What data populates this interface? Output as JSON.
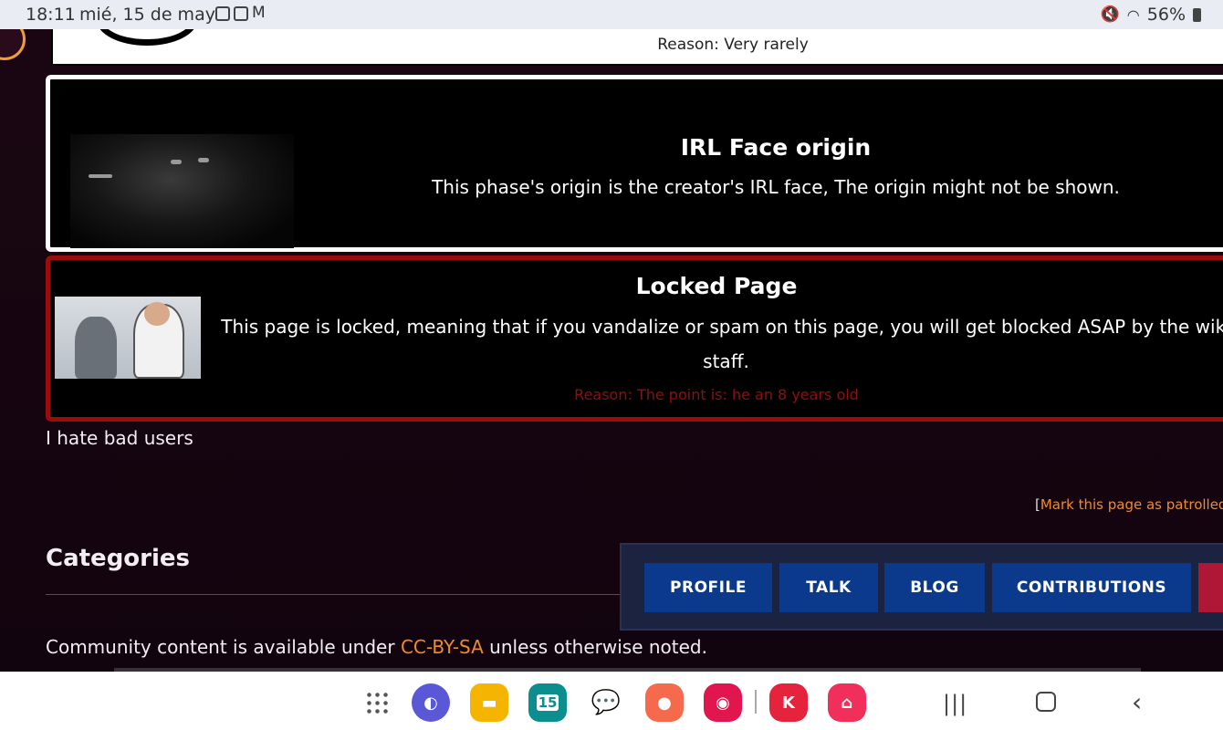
{
  "status_bar": {
    "time": "18:11",
    "date": "mié, 15 de may",
    "battery": "56%",
    "notification_icons": [
      "gallery-icon",
      "messenger-icon",
      "gmail-icon"
    ],
    "system_icons": [
      "mute-icon",
      "wifi-icon",
      "battery-icon"
    ]
  },
  "top_box": {
    "reason": "Reason: Very rarely"
  },
  "irl_box": {
    "title": "IRL Face origin",
    "text": "This phase's origin is the creator's IRL face, The origin might not be shown."
  },
  "locked_box": {
    "title": "Locked Page",
    "text": "This page is locked, meaning that if you vandalize or spam on this page, you will get blocked ASAP by the wiki staff.",
    "reason": "Reason: The point is: he an 8 years old",
    "border_color": "#9a0d0d",
    "reason_color": "#8e1010"
  },
  "content": {
    "hate_text": "I hate bad users",
    "patrol_bracket": "[",
    "patrol_link": "Mark this page as patrolled",
    "categories_heading": "Categories",
    "footer_prefix": "Community content is available under ",
    "footer_link": "CC-BY-SA",
    "footer_suffix": " unless otherwise noted.",
    "link_color": "#f08a2c"
  },
  "user_tabs": {
    "profile": "PROFILE",
    "talk": "TALK",
    "blog": "BLOG",
    "contributions": "CONTRIBUTIONS",
    "tab_color": "#0b3a8c"
  },
  "nav_bar": {
    "apps": [
      "app-drawer-icon",
      "internet-icon",
      "files-icon",
      "calendar-icon",
      "messages-icon",
      "contacts-icon",
      "screen-recorder-icon",
      "kinemaster-icon",
      "galaxy-store-icon"
    ],
    "calendar_day": "15"
  }
}
